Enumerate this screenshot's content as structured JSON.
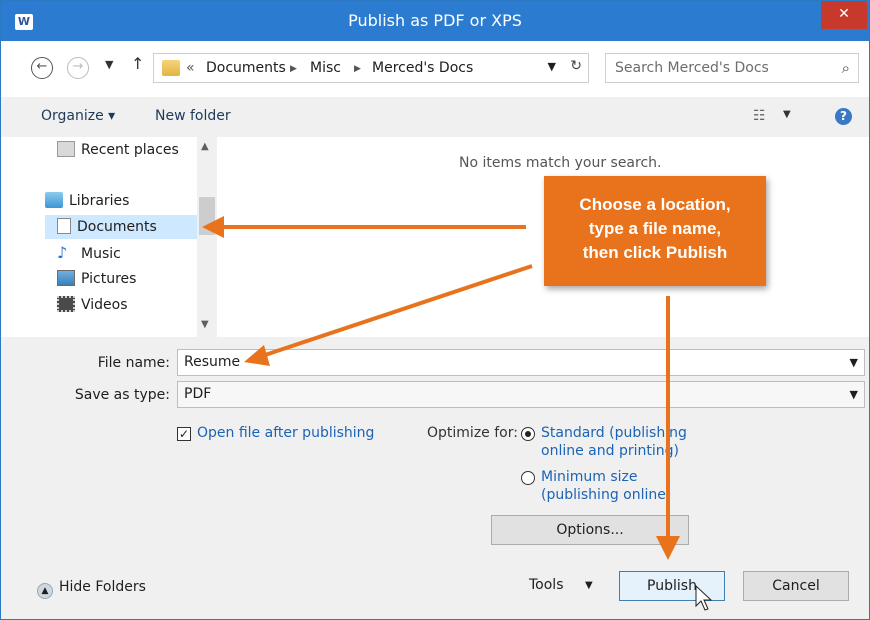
{
  "window": {
    "title": "Publish as PDF or XPS",
    "app_icon_label": "W",
    "close_glyph": "✕"
  },
  "address_bar": {
    "overflow": "«",
    "breadcrumbs": [
      "Documents",
      "Misc",
      "Merced's Docs"
    ],
    "search_placeholder": "Search Merced's Docs"
  },
  "toolbar": {
    "organize": "Organize ▾",
    "new_folder": "New folder"
  },
  "nav_pane": {
    "recent_places": "Recent places",
    "libraries": "Libraries",
    "documents": "Documents",
    "music": "Music",
    "pictures": "Pictures",
    "videos": "Videos"
  },
  "file_list": {
    "empty_message": "No items match your search."
  },
  "form": {
    "file_name_label": "File name:",
    "file_name_value": "Resume",
    "save_type_label": "Save as type:",
    "save_type_value": "PDF",
    "open_after_label": "Open file after publishing",
    "open_after_checked": true,
    "optimize_label": "Optimize for:",
    "standard_line1": "Standard (publishing",
    "standard_line2": "online and printing)",
    "minimum_line1": "Minimum size",
    "minimum_line2": "(publishing online)",
    "selected_option": "Standard (publishing online and printing)",
    "options_button": "Options..."
  },
  "footer": {
    "hide_folders": "Hide Folders",
    "tools": "Tools",
    "publish": "Publish",
    "cancel": "Cancel"
  },
  "callout": {
    "line1": "Choose a location,",
    "line2": "type a file name,",
    "line3": "then click Publish"
  },
  "colors": {
    "titlebar": "#2b7cd0",
    "close": "#c7392b",
    "callout": "#e8731c",
    "link": "#1b63b5"
  }
}
